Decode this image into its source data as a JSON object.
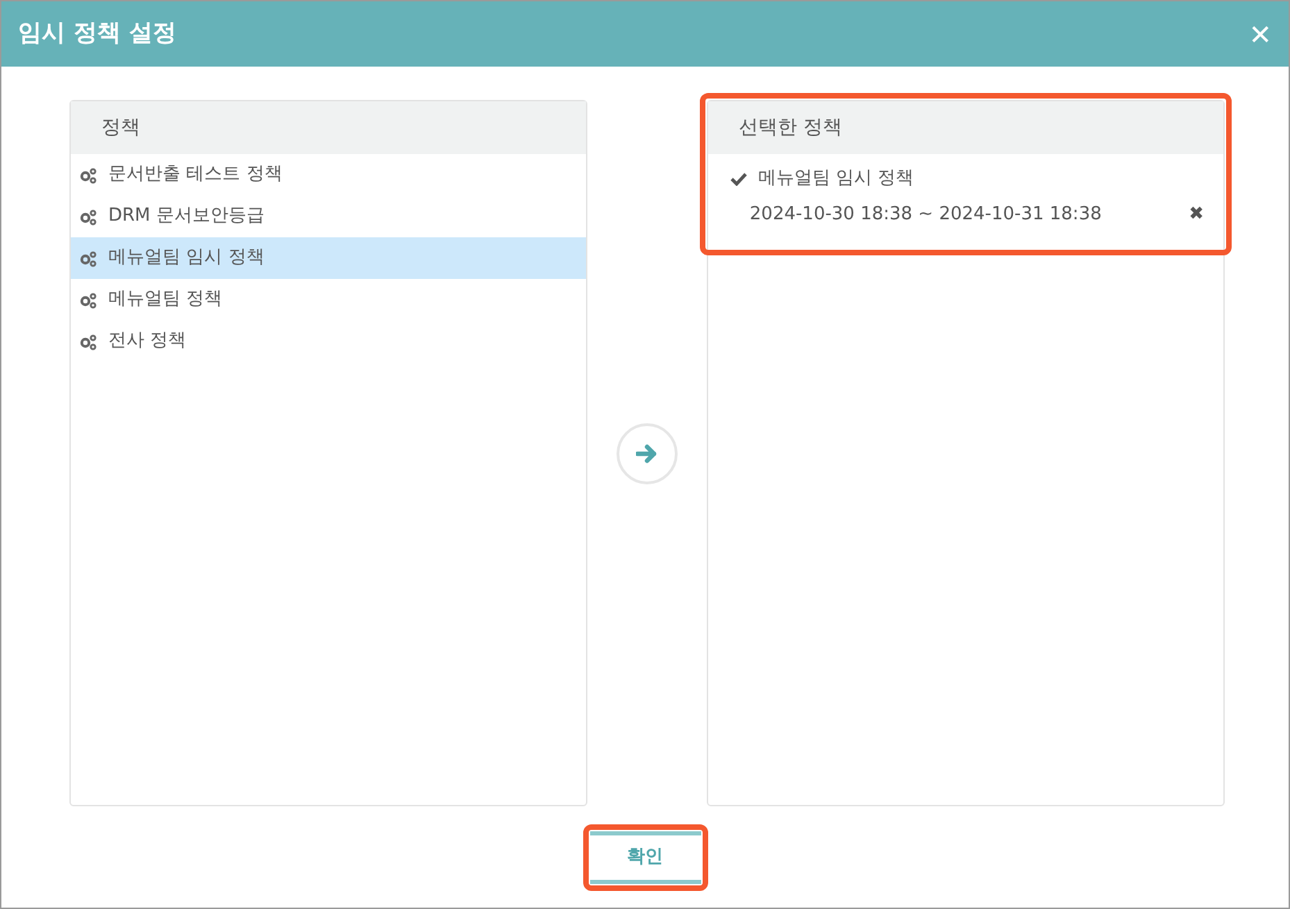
{
  "window": {
    "title": "임시 정책 설정",
    "close": "✕"
  },
  "policies": {
    "heading": "정책",
    "items": [
      {
        "label": "문서반출 테스트 정책",
        "selected": false
      },
      {
        "label": "DRM 문서보안등급",
        "selected": false
      },
      {
        "label": "메뉴얼팀 임시 정책",
        "selected": true
      },
      {
        "label": "메뉴얼팀 정책",
        "selected": false
      },
      {
        "label": "전사 정책",
        "selected": false
      }
    ]
  },
  "selected_policies": {
    "heading": "선택한 정책",
    "highlighted": true,
    "items": [
      {
        "label": "메뉴얼팀 임시 정책",
        "period": "2024-10-30 18:38 ~ 2024-10-31 18:38",
        "remove": "✖"
      }
    ]
  },
  "confirm_button": {
    "label": "확인",
    "highlighted": true
  }
}
